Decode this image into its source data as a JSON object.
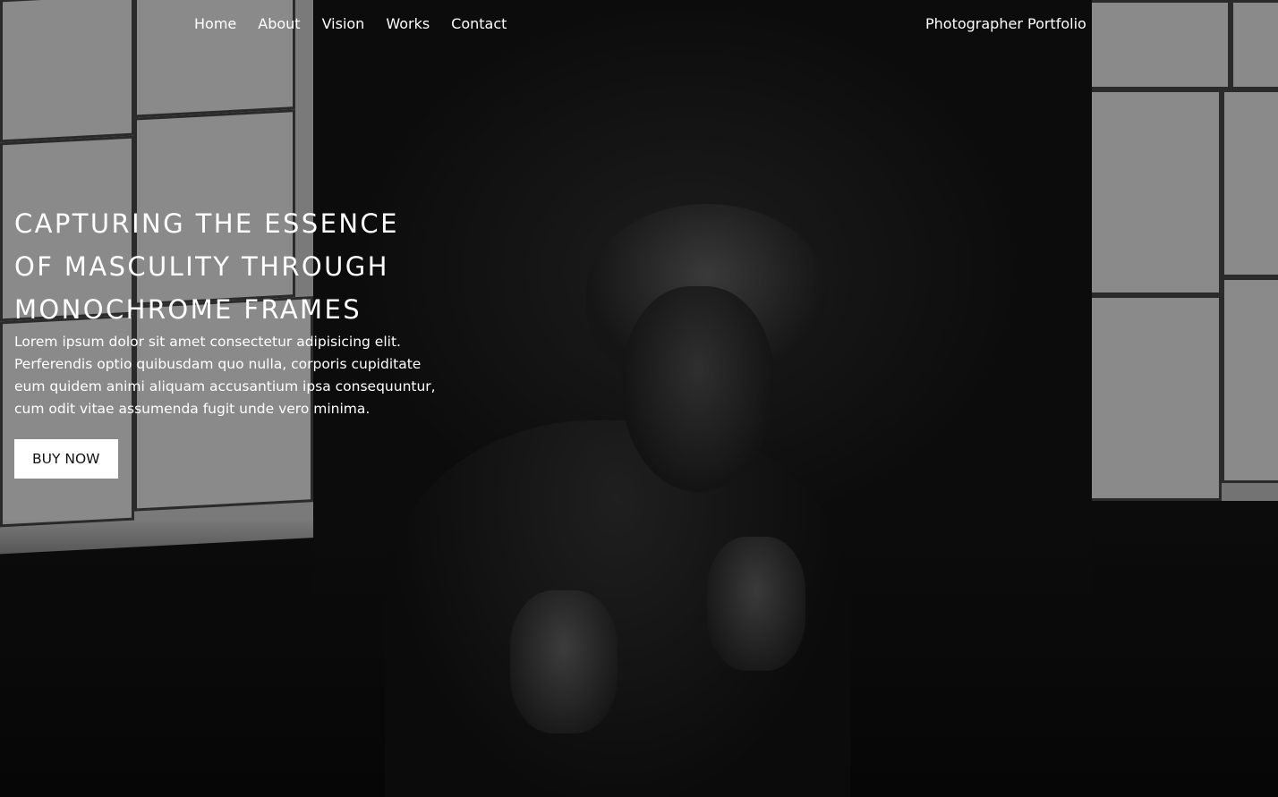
{
  "nav": {
    "items": [
      {
        "label": "Home"
      },
      {
        "label": "About"
      },
      {
        "label": "Vision"
      },
      {
        "label": "Works"
      },
      {
        "label": "Contact"
      }
    ],
    "brand": "Photographer Portfolio"
  },
  "hero": {
    "headline_lines": [
      "CAPTURING THE ESSENCE",
      "OF MASCULITY THROUGH",
      "MONOCHROME FRAMES"
    ],
    "body": "Lorem ipsum dolor sit amet consectetur adipisicing elit. Perferendis optio quibusdam quo nulla, corporis cupiditate eum quidem animi aliquam accusantium ipsa consequuntur, cum odit vitae assumenda fugit unde vero minima.",
    "cta_label": "BUY NOW"
  },
  "colors": {
    "text": "#ffffff",
    "button_bg": "#ffffff",
    "button_text": "#111111",
    "background": "#0b0b0b"
  }
}
